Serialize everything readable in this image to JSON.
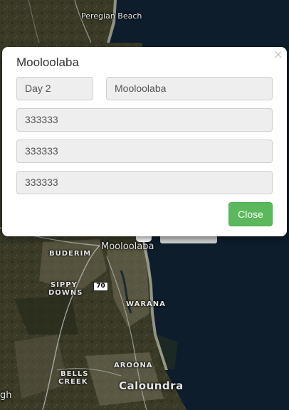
{
  "map": {
    "labels": {
      "peregian_beach": "Peregian Beach",
      "mooloolaba": "Mooloolaba",
      "buderim": "BUDERIM",
      "sippy": "SIPPY",
      "downs": "DOWNS",
      "warana": "WARANA",
      "aroona": "AROONA",
      "bells": "BELLS",
      "creek": "CREEK",
      "caloundra": "Caloundra",
      "edge_fragment": "gh"
    },
    "road_shield": "70",
    "colors": {
      "ocean": "#0d1d2c",
      "land": "#3b3a2a"
    }
  },
  "modal": {
    "title": "Mooloolaba",
    "close_glyph": "×",
    "fields": {
      "day": "Day 2",
      "name": "Mooloolaba",
      "field1": "333333",
      "field2": "333333",
      "field3": "333333"
    },
    "close_button_label": "Close",
    "colors": {
      "button": "#5cb85c",
      "field_bg": "#eeeeee"
    }
  }
}
